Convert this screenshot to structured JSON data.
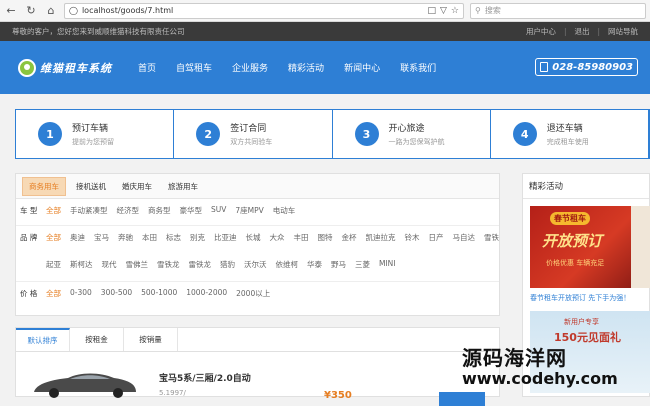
{
  "browser": {
    "url": "localhost/goods/7.html",
    "search_placeholder": "搜索"
  },
  "topbar": {
    "welcome": "尊敬的客户，您好您来到威顺维猫科技有限责任公司",
    "links": [
      "用户中心",
      "退出",
      "网站导航"
    ]
  },
  "header": {
    "logo_text": "维猫租车系统",
    "nav": [
      "首页",
      "自驾租车",
      "企业服务",
      "精彩活动",
      "新闻中心",
      "联系我们"
    ],
    "phone": "028-85980903"
  },
  "steps": [
    {
      "num": "1",
      "title": "预订车辆",
      "sub": "提前为您预留"
    },
    {
      "num": "2",
      "title": "签订合同",
      "sub": "双方共同验车"
    },
    {
      "num": "3",
      "title": "开心旅途",
      "sub": "一路为您保驾护航"
    },
    {
      "num": "4",
      "title": "退还车辆",
      "sub": "完成租车使用"
    }
  ],
  "filter": {
    "tabs": [
      "商务用车",
      "接机送机",
      "婚庆用车",
      "旅游用车"
    ],
    "type_label": "车  型",
    "types": [
      "全部",
      "手动紧凑型",
      "经济型",
      "商务型",
      "豪华型",
      "SUV",
      "7座MPV",
      "电动车"
    ],
    "brand_label": "品  牌",
    "brands": [
      "全部",
      "奥迪",
      "宝马",
      "奔驰",
      "本田",
      "标志",
      "别克",
      "比亚迪",
      "长城",
      "大众",
      "丰田",
      "图特",
      "金杯",
      "凯迪拉克",
      "铃木",
      "日产",
      "马自达",
      "雪铁",
      "起亚",
      "斯柯达",
      "现代",
      "雪佛兰",
      "雪铁龙",
      "雷铁龙",
      "猎豹",
      "沃尔沃",
      "依维柯",
      "华泰",
      "野马",
      "三菱",
      "MINI"
    ],
    "price_label": "价  格",
    "prices": [
      "全部",
      "0-300",
      "300-500",
      "500-1000",
      "1000-2000",
      "2000以上"
    ]
  },
  "sort": {
    "tabs": [
      "默认排序",
      "按租金",
      "按销量"
    ]
  },
  "car": {
    "name": "宝马5系/三厢/2.0自动",
    "desc": "5.1997/",
    "price": "¥350"
  },
  "side": {
    "title": "精彩活动",
    "promo1": {
      "tag": "春节租车",
      "big": "开放预订",
      "small": "价格优惠  车辆充足",
      "caption": "春节租车开放预订  先下手为强！"
    },
    "promo2": {
      "line1": "新用户专享",
      "line2": "150元见面礼",
      "sub": ""
    }
  },
  "watermark": {
    "line1": "源码海洋网",
    "line2": "www.codehy.com"
  }
}
